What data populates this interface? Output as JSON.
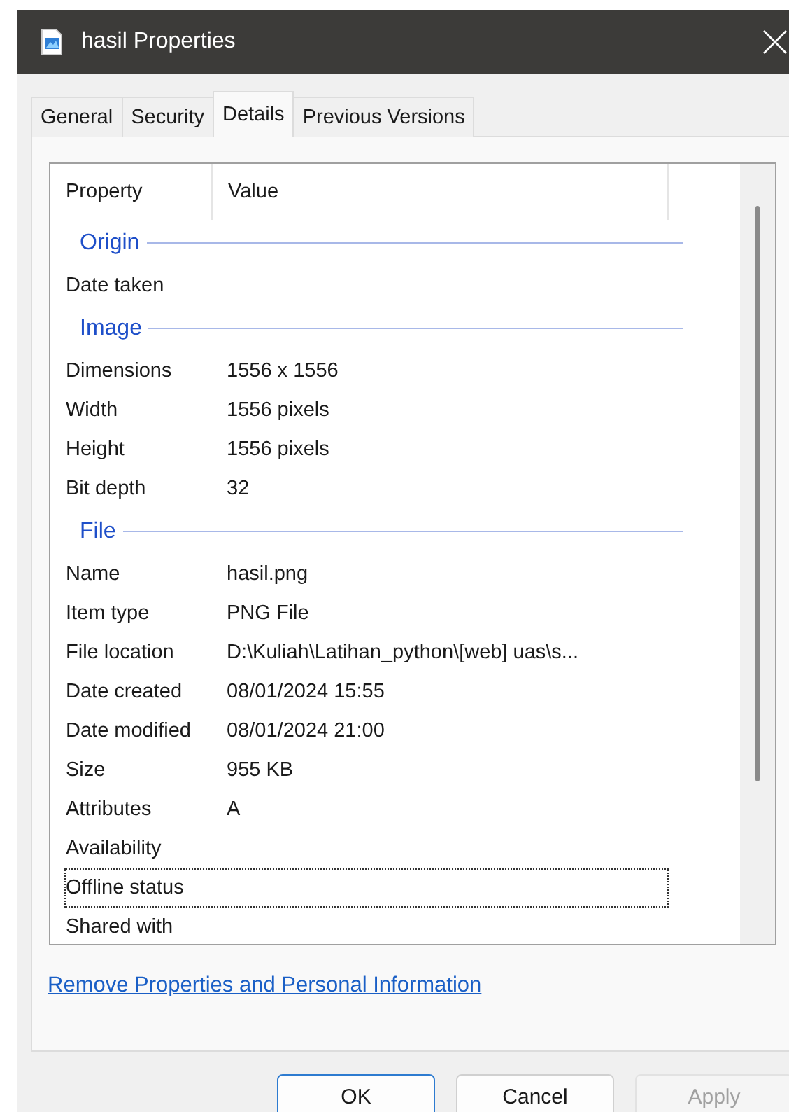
{
  "window": {
    "title": "hasil Properties"
  },
  "tabs": [
    {
      "label": "General",
      "selected": false
    },
    {
      "label": "Security",
      "selected": false
    },
    {
      "label": "Details",
      "selected": true
    },
    {
      "label": "Previous Versions",
      "selected": false
    }
  ],
  "details": {
    "columns": [
      "Property",
      "Value"
    ],
    "rows": [
      {
        "kind": "group",
        "name": "Origin"
      },
      {
        "kind": "property",
        "name": "Date taken",
        "focused": false
      },
      {
        "kind": "group",
        "name": "Image"
      },
      {
        "kind": "property",
        "name": "Dimensions",
        "value": "1556 x 1556",
        "focused": false
      },
      {
        "kind": "property",
        "name": "Width",
        "value": "1556 pixels",
        "focused": false
      },
      {
        "kind": "property",
        "name": "Height",
        "value": "1556 pixels",
        "focused": false
      },
      {
        "kind": "property",
        "name": "Bit depth",
        "value": "32",
        "focused": false
      },
      {
        "kind": "group",
        "name": "File"
      },
      {
        "kind": "property",
        "name": "Name",
        "value": "hasil.png",
        "focused": false
      },
      {
        "kind": "property",
        "name": "Item type",
        "value": "PNG File",
        "focused": false
      },
      {
        "kind": "property",
        "name": "File location",
        "value": "D:\\Kuliah\\Latihan_python\\[web] uas\\s...",
        "focused": false
      },
      {
        "kind": "property",
        "name": "Date created",
        "value": "08/01/2024 15:55",
        "focused": false
      },
      {
        "kind": "property",
        "name": "Date modified",
        "value": "08/01/2024 21:00",
        "focused": false
      },
      {
        "kind": "property",
        "name": "Size",
        "value": "955 KB",
        "focused": false
      },
      {
        "kind": "property",
        "name": "Attributes",
        "value": "A",
        "focused": false
      },
      {
        "kind": "property",
        "name": "Availability",
        "focused": false
      },
      {
        "kind": "property",
        "name": "Offline status",
        "focused": true
      },
      {
        "kind": "property",
        "name": "Shared with",
        "focused": false
      }
    ]
  },
  "link": "Remove Properties and Personal Information",
  "buttons": [
    {
      "label": "OK",
      "default": true,
      "disabled": false
    },
    {
      "label": "Cancel",
      "default": false,
      "disabled": false
    },
    {
      "label": "Apply",
      "default": false,
      "disabled": true
    }
  ]
}
